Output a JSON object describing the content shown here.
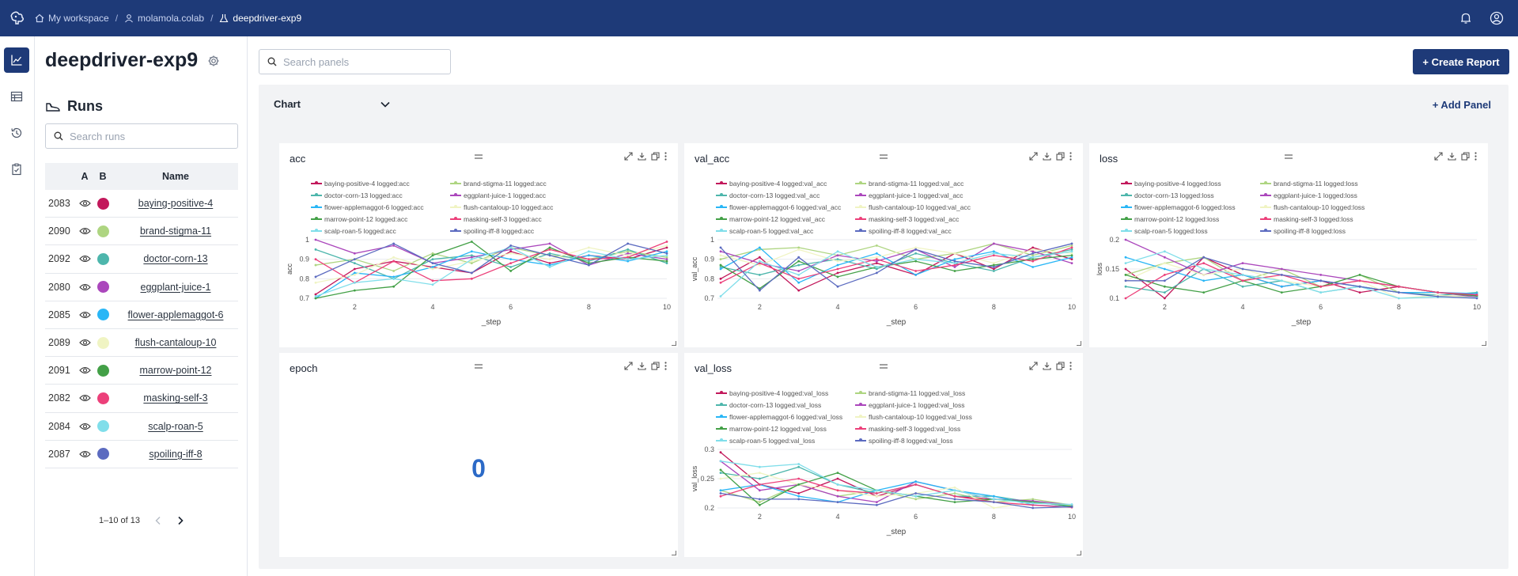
{
  "breadcrumb": {
    "workspace": "My workspace",
    "user": "molamola.colab",
    "project": "deepdriver-exp9"
  },
  "project_title": "deepdriver-exp9",
  "runs_panel": {
    "title": "Runs",
    "search_placeholder": "Search runs",
    "columns": {
      "a": "A",
      "b": "B",
      "name": "Name"
    },
    "rows": [
      {
        "id": "2083",
        "name": "baying-positive-4",
        "color": "#c2185b"
      },
      {
        "id": "2090",
        "name": "brand-stigma-11",
        "color": "#aed581"
      },
      {
        "id": "2092",
        "name": "doctor-corn-13",
        "color": "#4db6ac"
      },
      {
        "id": "2080",
        "name": "eggplant-juice-1",
        "color": "#ab47bc"
      },
      {
        "id": "2085",
        "name": "flower-applemaggot-6",
        "color": "#29b6f6"
      },
      {
        "id": "2089",
        "name": "flush-cantaloup-10",
        "color": "#f0f4c3"
      },
      {
        "id": "2091",
        "name": "marrow-point-12",
        "color": "#43a047"
      },
      {
        "id": "2082",
        "name": "masking-self-3",
        "color": "#ec407a"
      },
      {
        "id": "2084",
        "name": "scalp-roan-5",
        "color": "#80deea"
      },
      {
        "id": "2087",
        "name": "spoiling-iff-8",
        "color": "#5c6bc0"
      }
    ],
    "pagination": "1–10 of 13"
  },
  "main": {
    "search_placeholder": "Search panels",
    "create_report": "+ Create Report",
    "section_title": "Chart",
    "add_panel": "+ Add Panel",
    "epoch_title": "epoch",
    "epoch_value": "0"
  },
  "icons": {
    "logo": "brain-logo-icon",
    "home": "home-icon",
    "user": "user-icon",
    "project": "flask-icon",
    "bell": "bell-icon",
    "account": "account-icon",
    "rail": [
      "line-chart-icon",
      "table-icon",
      "history-icon",
      "clipboard-icon"
    ],
    "card_tools": [
      "expand-icon",
      "download-icon",
      "copy-icon",
      "more-icon"
    ]
  },
  "chart_data": [
    {
      "id": "acc",
      "type": "line",
      "title": "acc",
      "xlabel": "_step",
      "ylabel": "acc",
      "suffix": "acc",
      "x": [
        1,
        2,
        3,
        4,
        5,
        6,
        7,
        8,
        9,
        10
      ],
      "xticks": [
        "2",
        "4",
        "6",
        "8",
        "10"
      ],
      "yticks": [
        "0.7",
        "0.8",
        "0.9",
        "1"
      ],
      "ylim": [
        0.7,
        1.0
      ],
      "series": [
        {
          "name": "baying-positive-4 logged:acc",
          "color": "#c2185b",
          "values": [
            0.72,
            0.85,
            0.89,
            0.86,
            0.83,
            0.94,
            0.88,
            0.92,
            0.9,
            0.96
          ]
        },
        {
          "name": "brand-stigma-11 logged:acc",
          "color": "#aed581",
          "values": [
            0.87,
            0.9,
            0.84,
            0.93,
            0.88,
            0.96,
            0.92,
            0.9,
            0.94,
            0.91
          ]
        },
        {
          "name": "doctor-corn-13 logged:acc",
          "color": "#4db6ac",
          "values": [
            0.95,
            0.88,
            0.8,
            0.9,
            0.92,
            0.86,
            0.93,
            0.89,
            0.95,
            0.88
          ]
        },
        {
          "name": "eggplant-juice-1 logged:acc",
          "color": "#ab47bc",
          "values": [
            1.0,
            0.93,
            0.97,
            0.88,
            0.91,
            0.95,
            0.98,
            0.87,
            0.93,
            0.9
          ]
        },
        {
          "name": "flower-applemaggot-6 logged:acc",
          "color": "#29b6f6",
          "values": [
            0.7,
            0.83,
            0.81,
            0.86,
            0.94,
            0.9,
            0.87,
            0.92,
            0.89,
            0.94
          ]
        },
        {
          "name": "flush-cantaloup-10 logged:acc",
          "color": "#f0f4c3",
          "values": [
            0.78,
            0.82,
            0.91,
            0.85,
            0.89,
            0.93,
            0.9,
            0.96,
            0.92,
            0.97
          ]
        },
        {
          "name": "marrow-point-12 logged:acc",
          "color": "#43a047",
          "values": [
            0.7,
            0.74,
            0.76,
            0.92,
            0.99,
            0.84,
            0.96,
            0.88,
            0.91,
            0.89
          ]
        },
        {
          "name": "masking-self-3 logged:acc",
          "color": "#ec407a",
          "values": [
            0.9,
            0.78,
            0.89,
            0.79,
            0.8,
            0.88,
            0.95,
            0.9,
            0.91,
            0.99
          ]
        },
        {
          "name": "scalp-roan-5 logged:acc",
          "color": "#80deea",
          "values": [
            0.71,
            0.78,
            0.8,
            0.77,
            0.9,
            0.96,
            0.86,
            0.94,
            0.9,
            0.92
          ]
        },
        {
          "name": "spoiling-iff-8 logged:acc",
          "color": "#5c6bc0",
          "values": [
            0.81,
            0.9,
            0.98,
            0.88,
            0.83,
            0.97,
            0.92,
            0.87,
            0.98,
            0.93
          ]
        }
      ]
    },
    {
      "id": "val_acc",
      "type": "line",
      "title": "val_acc",
      "xlabel": "_step",
      "ylabel": "val_acc",
      "suffix": "val_acc",
      "x": [
        1,
        2,
        3,
        4,
        5,
        6,
        7,
        8,
        9,
        10
      ],
      "xticks": [
        "2",
        "4",
        "6",
        "8",
        "10"
      ],
      "yticks": [
        "0.7",
        "0.8",
        "0.9",
        "1"
      ],
      "ylim": [
        0.7,
        1.0
      ],
      "series": [
        {
          "name": "baying-positive-4 logged:val_acc",
          "color": "#c2185b",
          "values": [
            0.8,
            0.91,
            0.74,
            0.83,
            0.88,
            0.82,
            0.93,
            0.85,
            0.96,
            0.9
          ]
        },
        {
          "name": "brand-stigma-11 logged:val_acc",
          "color": "#aed581",
          "values": [
            0.9,
            0.95,
            0.96,
            0.92,
            0.97,
            0.9,
            0.93,
            0.98,
            0.92,
            0.97
          ]
        },
        {
          "name": "doctor-corn-13 logged:val_acc",
          "color": "#4db6ac",
          "values": [
            0.86,
            0.82,
            0.87,
            0.9,
            0.85,
            0.93,
            0.88,
            0.84,
            0.91,
            0.95
          ]
        },
        {
          "name": "eggplant-juice-1 logged:val_acc",
          "color": "#ab47bc",
          "values": [
            0.94,
            0.88,
            0.84,
            0.92,
            0.89,
            0.95,
            0.86,
            0.98,
            0.94,
            0.88
          ]
        },
        {
          "name": "flower-applemaggot-6 logged:val_acc",
          "color": "#29b6f6",
          "values": [
            0.85,
            0.96,
            0.78,
            0.87,
            0.93,
            0.82,
            0.9,
            0.94,
            0.86,
            0.91
          ]
        },
        {
          "name": "flush-cantaloup-10 logged:val_acc",
          "color": "#f0f4c3",
          "values": [
            0.92,
            0.87,
            0.95,
            0.89,
            0.91,
            0.96,
            0.93,
            0.88,
            0.95,
            0.93
          ]
        },
        {
          "name": "marrow-point-12 logged:val_acc",
          "color": "#43a047",
          "values": [
            0.87,
            0.75,
            0.89,
            0.81,
            0.86,
            0.89,
            0.84,
            0.87,
            0.9,
            0.92
          ]
        },
        {
          "name": "masking-self-3 logged:val_acc",
          "color": "#ec407a",
          "values": [
            0.78,
            0.88,
            0.8,
            0.85,
            0.9,
            0.84,
            0.87,
            0.92,
            0.89,
            0.96
          ]
        },
        {
          "name": "scalp-roan-5 logged:val_acc",
          "color": "#80deea",
          "values": [
            0.71,
            0.89,
            0.82,
            0.94,
            0.86,
            0.9,
            0.88,
            0.93,
            0.91,
            0.94
          ]
        },
        {
          "name": "spoiling-iff-8 logged:val_acc",
          "color": "#5c6bc0",
          "values": [
            0.96,
            0.74,
            0.91,
            0.76,
            0.83,
            0.95,
            0.89,
            0.86,
            0.93,
            0.98
          ]
        }
      ]
    },
    {
      "id": "loss",
      "type": "line",
      "title": "loss",
      "xlabel": "_step",
      "ylabel": "loss",
      "suffix": "loss",
      "x": [
        1,
        2,
        3,
        4,
        5,
        6,
        7,
        8,
        9,
        10
      ],
      "xticks": [
        "2",
        "4",
        "6",
        "8",
        "10"
      ],
      "yticks": [
        "0.1",
        "0.15",
        "0.2"
      ],
      "ylim": [
        0.1,
        0.2
      ],
      "series": [
        {
          "name": "baying-positive-4 logged:loss",
          "color": "#c2185b",
          "values": [
            0.15,
            0.1,
            0.17,
            0.14,
            0.12,
            0.13,
            0.11,
            0.12,
            0.11,
            0.105
          ]
        },
        {
          "name": "brand-stigma-11 logged:loss",
          "color": "#aed581",
          "values": [
            0.14,
            0.16,
            0.17,
            0.13,
            0.15,
            0.12,
            0.14,
            0.11,
            0.105,
            0.102
          ]
        },
        {
          "name": "doctor-corn-13 logged:loss",
          "color": "#4db6ac",
          "values": [
            0.12,
            0.11,
            0.15,
            0.12,
            0.13,
            0.11,
            0.12,
            0.11,
            0.105,
            0.11
          ]
        },
        {
          "name": "eggplant-juice-1 logged:loss",
          "color": "#ab47bc",
          "values": [
            0.2,
            0.17,
            0.14,
            0.16,
            0.15,
            0.14,
            0.13,
            0.12,
            0.11,
            0.102
          ]
        },
        {
          "name": "flower-applemaggot-6 logged:loss",
          "color": "#29b6f6",
          "values": [
            0.17,
            0.15,
            0.13,
            0.14,
            0.12,
            0.13,
            0.12,
            0.11,
            0.11,
            0.108
          ]
        },
        {
          "name": "flush-cantaloup-10 logged:loss",
          "color": "#f0f4c3",
          "values": [
            0.13,
            0.16,
            0.14,
            0.15,
            0.13,
            0.12,
            0.13,
            0.1,
            0.105,
            0.101
          ]
        },
        {
          "name": "marrow-point-12 logged:loss",
          "color": "#43a047",
          "values": [
            0.14,
            0.12,
            0.11,
            0.13,
            0.11,
            0.12,
            0.14,
            0.12,
            0.11,
            0.104
          ]
        },
        {
          "name": "masking-self-3 logged:loss",
          "color": "#ec407a",
          "values": [
            0.1,
            0.14,
            0.16,
            0.13,
            0.14,
            0.12,
            0.13,
            0.12,
            0.11,
            0.106
          ]
        },
        {
          "name": "scalp-roan-5 logged:loss",
          "color": "#80deea",
          "values": [
            0.16,
            0.18,
            0.15,
            0.14,
            0.13,
            0.11,
            0.12,
            0.1,
            0.102,
            0.101
          ]
        },
        {
          "name": "spoiling-iff-8 logged:loss",
          "color": "#5c6bc0",
          "values": [
            0.13,
            0.13,
            0.17,
            0.15,
            0.14,
            0.13,
            0.12,
            0.11,
            0.103,
            0.1
          ]
        }
      ]
    },
    {
      "id": "val_loss",
      "type": "line",
      "title": "val_loss",
      "xlabel": "_step",
      "ylabel": "val_loss",
      "suffix": "val_loss",
      "x": [
        1,
        2,
        3,
        4,
        5,
        6,
        7,
        8,
        9,
        10
      ],
      "xticks": [
        "2",
        "4",
        "6",
        "8",
        "10"
      ],
      "yticks": [
        "0.2",
        "0.25",
        "0.3"
      ],
      "ylim": [
        0.2,
        0.3
      ],
      "series": [
        {
          "name": "baying-positive-4 logged:val_loss",
          "color": "#c2185b",
          "values": [
            0.295,
            0.24,
            0.225,
            0.25,
            0.22,
            0.24,
            0.22,
            0.215,
            0.21,
            0.205
          ]
        },
        {
          "name": "brand-stigma-11 logged:val_loss",
          "color": "#aed581",
          "values": [
            0.23,
            0.21,
            0.24,
            0.22,
            0.23,
            0.215,
            0.225,
            0.21,
            0.215,
            0.205
          ]
        },
        {
          "name": "doctor-corn-13 logged:val_loss",
          "color": "#4db6ac",
          "values": [
            0.26,
            0.25,
            0.27,
            0.24,
            0.225,
            0.24,
            0.22,
            0.22,
            0.21,
            0.203
          ]
        },
        {
          "name": "eggplant-juice-1 logged:val_loss",
          "color": "#ab47bc",
          "values": [
            0.28,
            0.23,
            0.24,
            0.22,
            0.21,
            0.245,
            0.23,
            0.215,
            0.212,
            0.205
          ]
        },
        {
          "name": "flower-applemaggot-6 logged:val_loss",
          "color": "#29b6f6",
          "values": [
            0.23,
            0.24,
            0.22,
            0.21,
            0.23,
            0.245,
            0.23,
            0.22,
            0.205,
            0.202
          ]
        },
        {
          "name": "flush-cantaloup-10 logged:val_loss",
          "color": "#f0f4c3",
          "values": [
            0.25,
            0.26,
            0.24,
            0.23,
            0.22,
            0.225,
            0.235,
            0.2,
            0.21,
            0.204
          ]
        },
        {
          "name": "marrow-point-12 logged:val_loss",
          "color": "#43a047",
          "values": [
            0.265,
            0.205,
            0.24,
            0.26,
            0.23,
            0.22,
            0.21,
            0.215,
            0.21,
            0.203
          ]
        },
        {
          "name": "masking-self-3 logged:val_loss",
          "color": "#ec407a",
          "values": [
            0.22,
            0.24,
            0.25,
            0.23,
            0.225,
            0.24,
            0.22,
            0.21,
            0.205,
            0.201
          ]
        },
        {
          "name": "scalp-roan-5 logged:val_loss",
          "color": "#80deea",
          "values": [
            0.28,
            0.27,
            0.275,
            0.24,
            0.23,
            0.22,
            0.23,
            0.215,
            0.208,
            0.206
          ]
        },
        {
          "name": "spoiling-iff-8 logged:val_loss",
          "color": "#5c6bc0",
          "values": [
            0.225,
            0.215,
            0.215,
            0.21,
            0.205,
            0.225,
            0.215,
            0.21,
            0.2,
            0.202
          ]
        }
      ]
    }
  ]
}
